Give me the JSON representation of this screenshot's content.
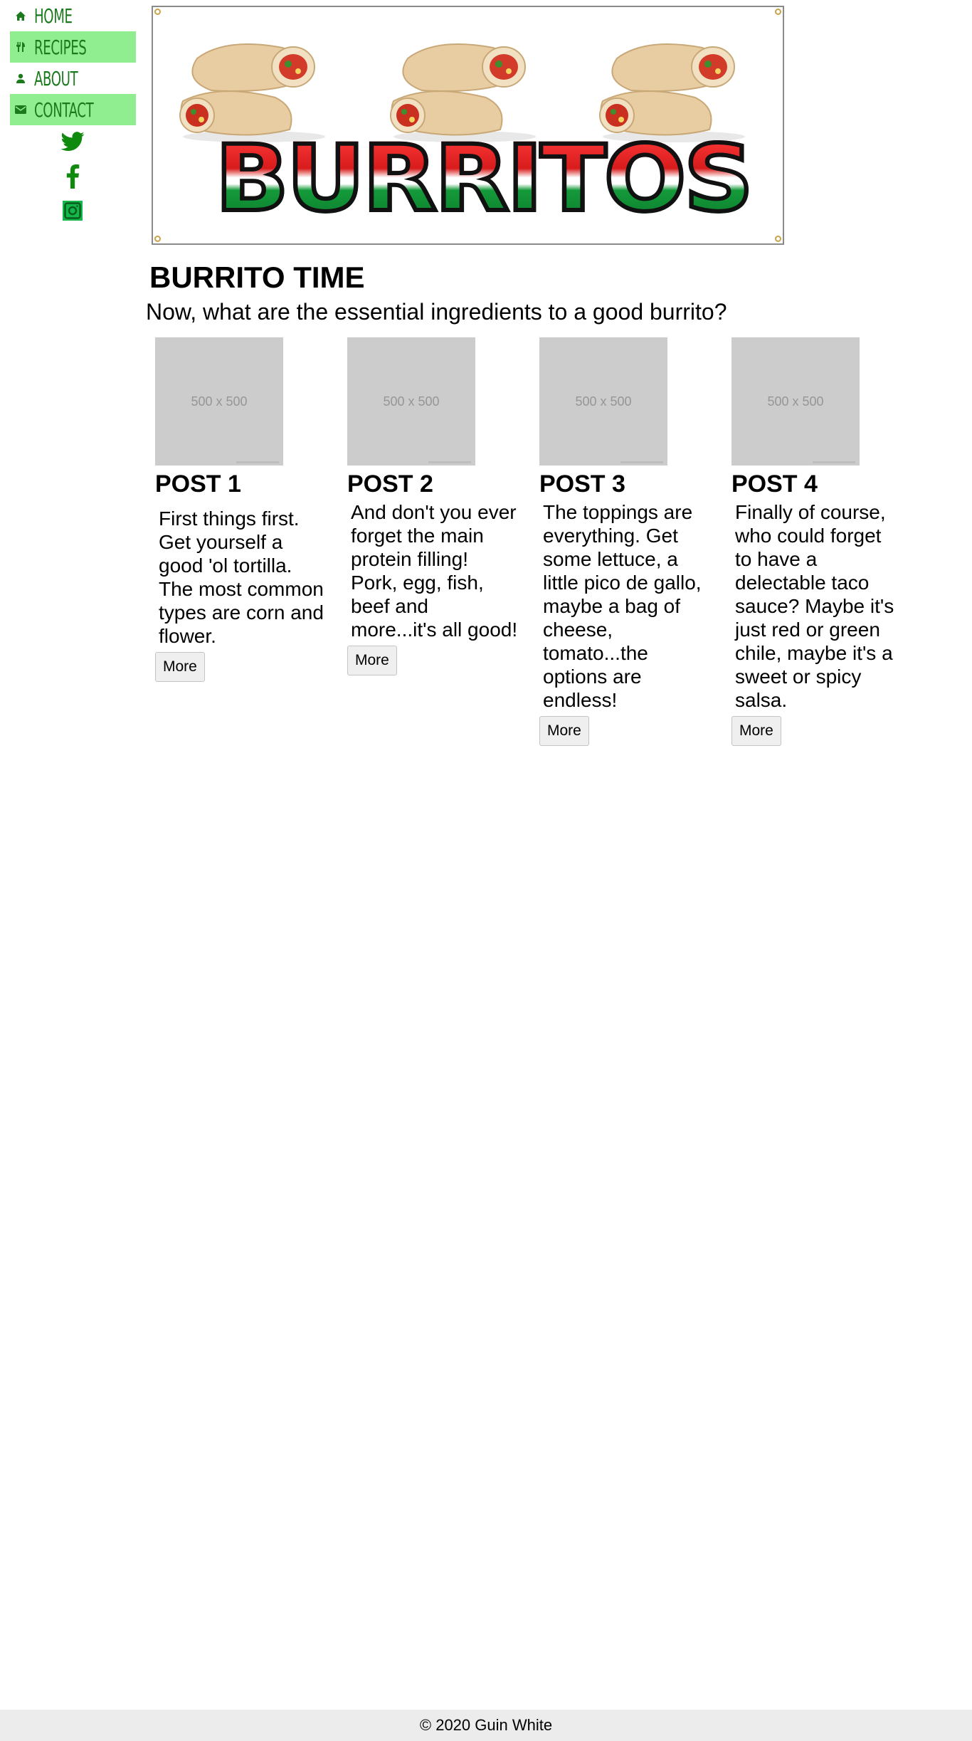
{
  "nav": {
    "items": [
      {
        "label": "HOME",
        "icon": "home-icon"
      },
      {
        "label": "RECIPES",
        "icon": "utensils-icon"
      },
      {
        "label": "ABOUT",
        "icon": "person-icon"
      },
      {
        "label": "CONTACT",
        "icon": "mail-icon"
      }
    ],
    "social": [
      "twitter-icon",
      "facebook-icon",
      "instagram-icon"
    ],
    "highlight_color": "#90ee90",
    "text_color": "#1b7a1b"
  },
  "banner": {
    "word": "BURRITOS"
  },
  "main": {
    "title": "BURRITO TIME",
    "subtitle": "Now, what are the essential ingredients to a good burrito?"
  },
  "posts": [
    {
      "image_text": "500 x 500",
      "title": "POST 1",
      "body": "First things first. Get yourself a good 'ol tortilla. The most common types are corn and flower.",
      "button": "More"
    },
    {
      "image_text": "500 x 500",
      "title": "POST 2",
      "body": "And don't you ever forget the main protein filling! Pork, egg, fish, beef and more...it's all good!",
      "button": "More"
    },
    {
      "image_text": "500 x 500",
      "title": "POST 3",
      "body": "The toppings are everything. Get some lettuce, a little pico de gallo, maybe a bag of cheese, tomato...the options are endless!",
      "button": "More"
    },
    {
      "image_text": "500 x 500",
      "title": "POST 4",
      "body": "Finally of course, who could forget to have a delectable taco sauce? Maybe it's just red or green chile, maybe it's a sweet or spicy salsa.",
      "button": "More"
    }
  ],
  "footer": {
    "text": "© 2020 Guin White"
  }
}
